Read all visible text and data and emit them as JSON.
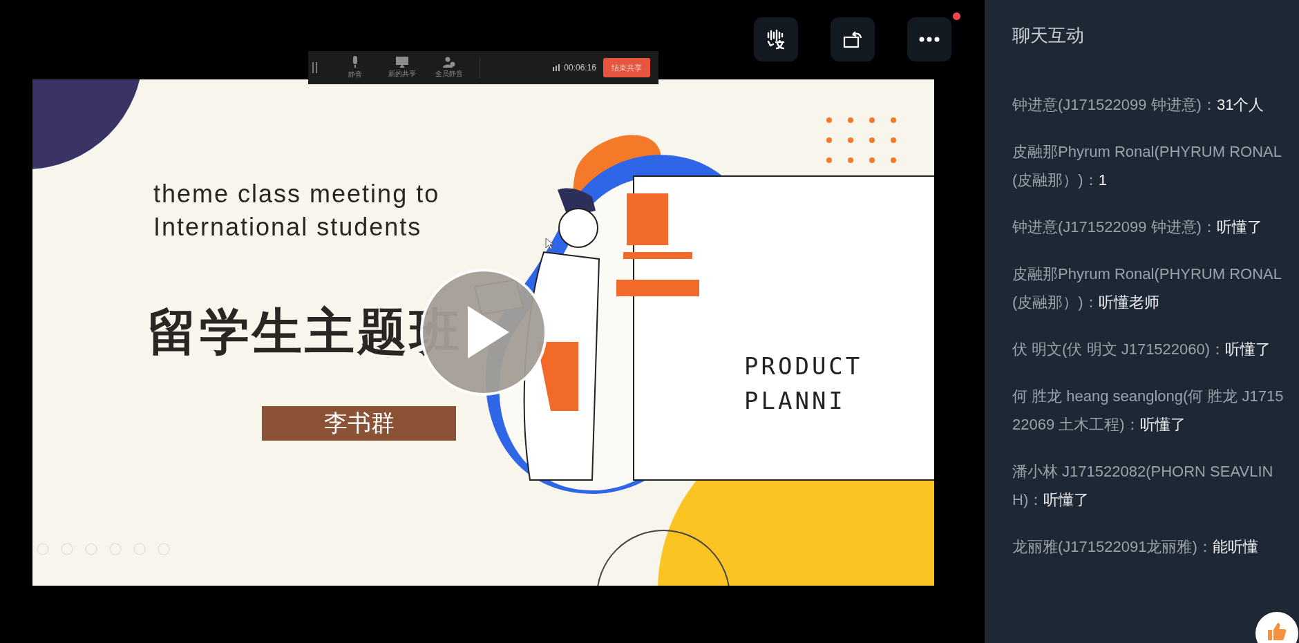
{
  "top_controls": [
    {
      "kind": "captions",
      "notification": false
    },
    {
      "kind": "rotate",
      "notification": false
    },
    {
      "kind": "more",
      "notification": true
    }
  ],
  "share_toolbar": {
    "items": [
      {
        "kind": "mic",
        "label": "静音"
      },
      {
        "kind": "screen",
        "label": "新的共享"
      },
      {
        "kind": "mute_all",
        "label": "全员静音"
      }
    ],
    "timer": "00:06:16",
    "stop_button": "结束共享"
  },
  "slide": {
    "title_en": [
      "theme class meeting to",
      "International students"
    ],
    "title_cn": "留学生主题班",
    "presenter": "李书群",
    "board_text": [
      "PRODUCT",
      "PLANNI"
    ]
  },
  "chat": {
    "title": "聊天互动",
    "messages": [
      {
        "sender": "钟进意(J171522099 钟进意)：",
        "text": "31个人"
      },
      {
        "sender": "皮融那Phyrum Ronal(PHYRUM RONAL (皮融那）)：",
        "text": "1"
      },
      {
        "sender": "钟进意(J171522099 钟进意)：",
        "text": "听懂了"
      },
      {
        "sender": "皮融那Phyrum Ronal(PHYRUM RONAL (皮融那）)：",
        "text": "听懂老师"
      },
      {
        "sender": "伏 明文(伏 明文 J171522060)：",
        "text": "听懂了"
      },
      {
        "sender": "何 胜龙 heang seanglong(何 胜龙 J171522069 土木工程)：",
        "text": "听懂了"
      },
      {
        "sender": "潘小林 J171522082(PHORN SEAVLINH)：",
        "text": "听懂了"
      },
      {
        "sender": "龙丽雅(J171522091龙丽雅)：",
        "text": "能听懂"
      }
    ]
  }
}
